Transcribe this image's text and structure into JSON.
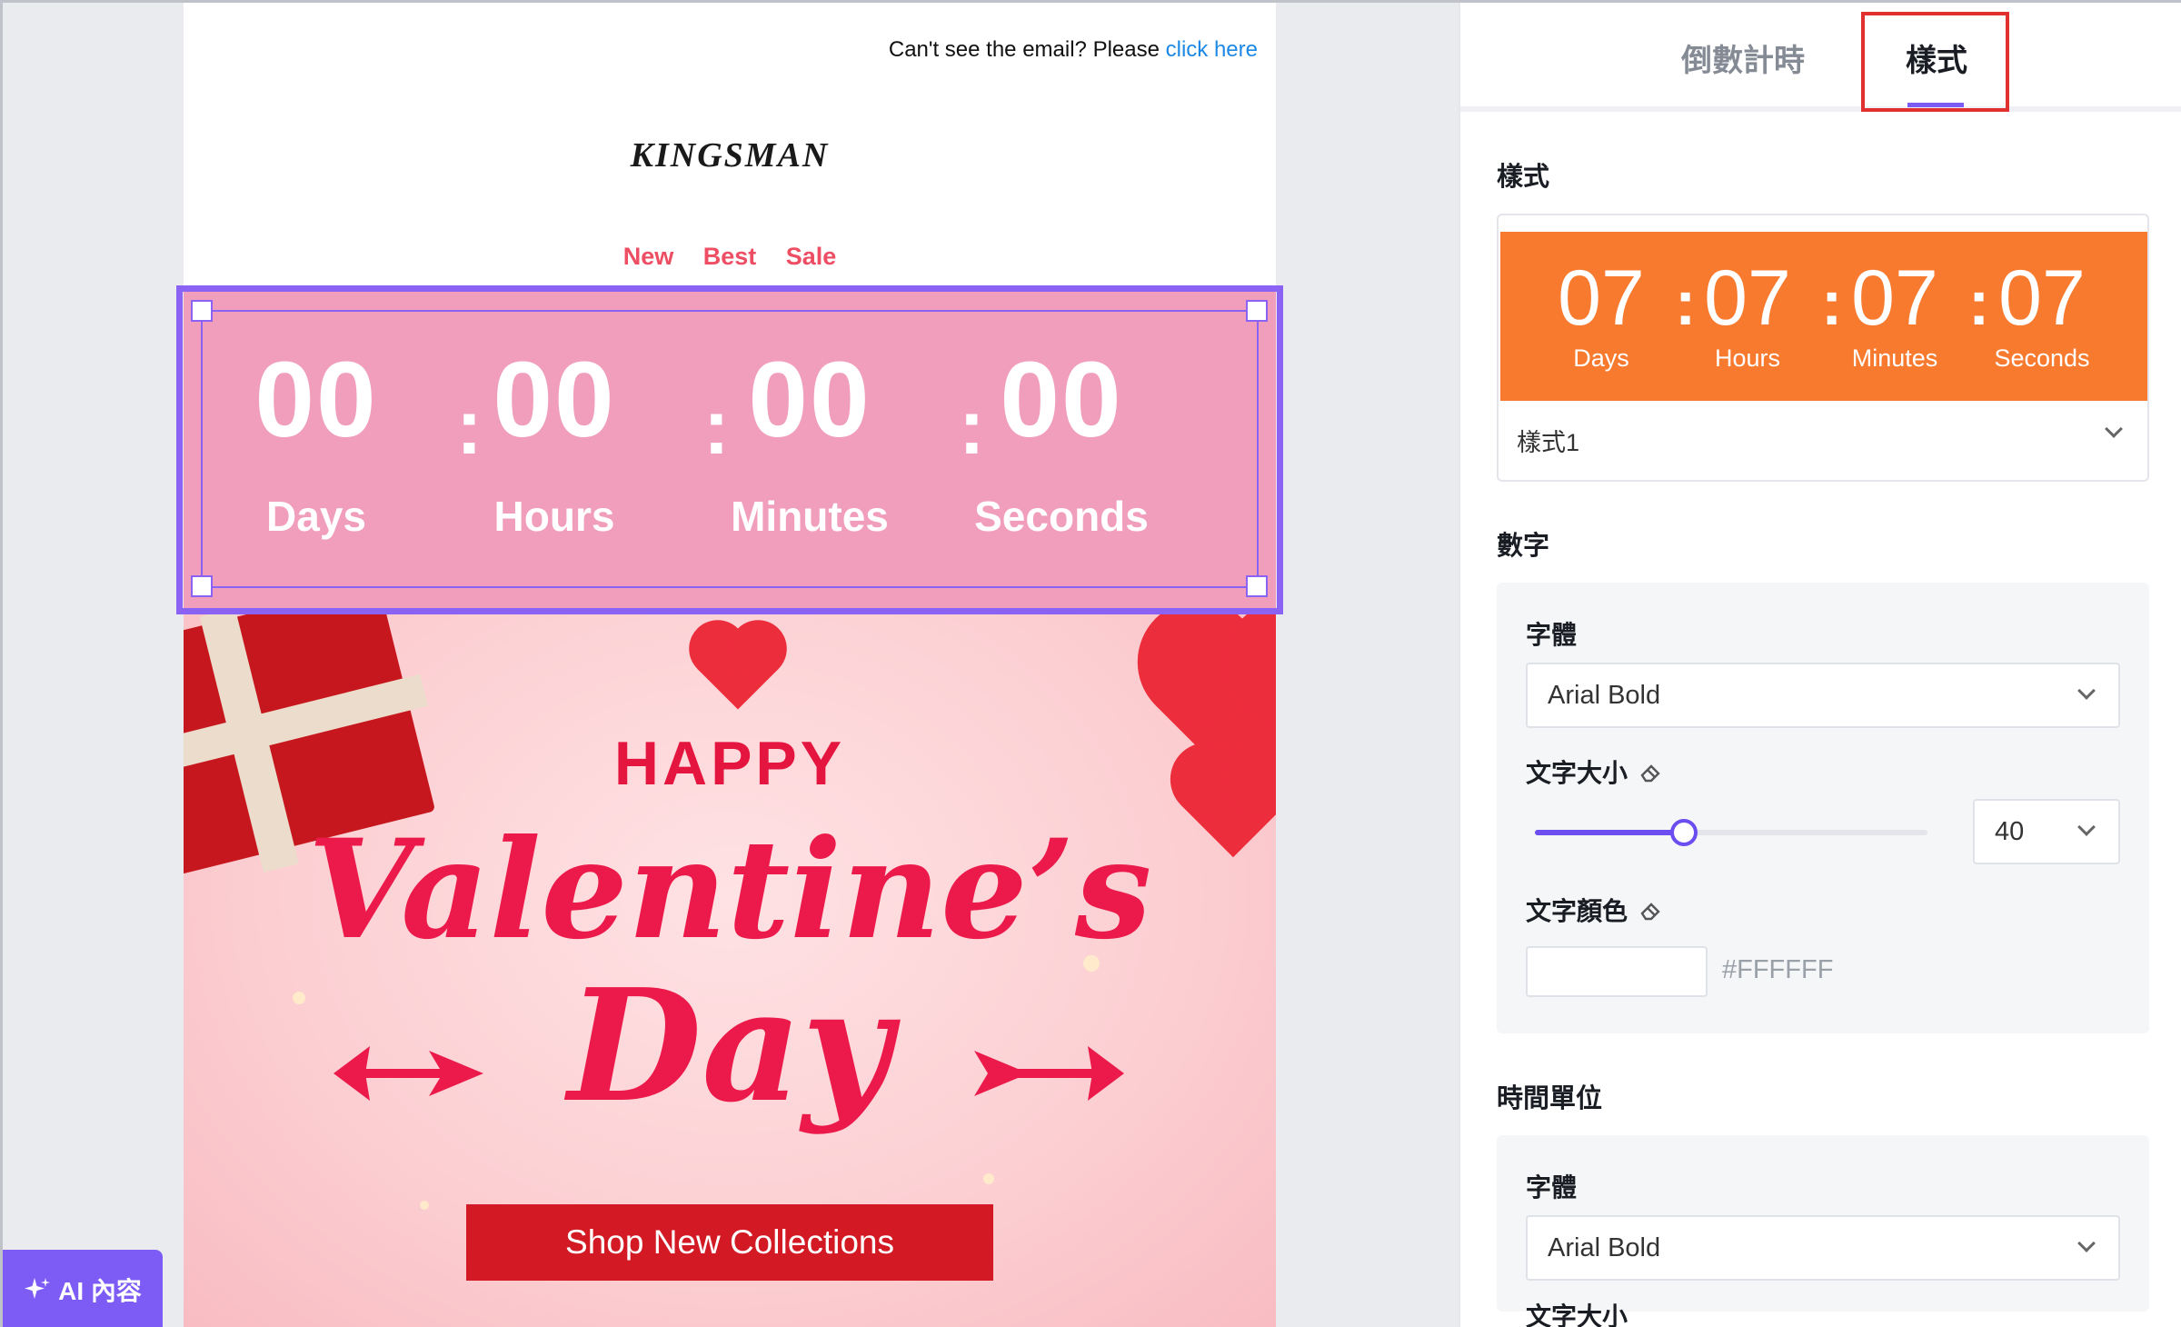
{
  "email": {
    "preheader_text": "Can't see the email? Please",
    "preheader_link": "click here",
    "brand": "KINGSMAN",
    "nav": [
      "New",
      "Best",
      "Sale"
    ],
    "countdown": {
      "values": [
        "00",
        "00",
        "00",
        "00"
      ],
      "labels": [
        "Days",
        "Hours",
        "Minutes",
        "Seconds"
      ],
      "separator": ":",
      "background": "#f19ebc",
      "color": "#ffffff"
    },
    "hero": {
      "happy": "HAPPY",
      "title_line1": "Valentine’s",
      "title_line2": "Day",
      "cta": "Shop New Collections"
    },
    "selection_color": "#8a63f4"
  },
  "ai_button": {
    "label": "AI 內容",
    "icon": "sparkle-icon"
  },
  "panel": {
    "tabs": [
      {
        "label": "倒數計時",
        "active": false
      },
      {
        "label": "樣式",
        "active": true
      }
    ],
    "style_section": {
      "title": "樣式",
      "preview": {
        "values": [
          "07",
          "07",
          "07",
          "07"
        ],
        "labels": [
          "Days",
          "Hours",
          "Minutes",
          "Seconds"
        ],
        "separator": ":",
        "background": "#f77a2e"
      },
      "selected_style": "樣式1"
    },
    "number_section": {
      "title": "數字",
      "font_label": "字體",
      "font_value": "Arial Bold",
      "size_label": "文字大小",
      "size_value": "40",
      "size_slider_fraction": 0.38,
      "color_label": "文字顏色",
      "color_value": "#FFFFFF"
    },
    "unit_section": {
      "title": "時間單位",
      "font_label": "字體",
      "font_value": "Arial Bold",
      "size_label": "文字大小"
    }
  },
  "colors": {
    "accent": "#7c5cf5",
    "tab_highlight": "#e03030",
    "cta": "#d31a24",
    "title_red": "#ec1a4b"
  }
}
